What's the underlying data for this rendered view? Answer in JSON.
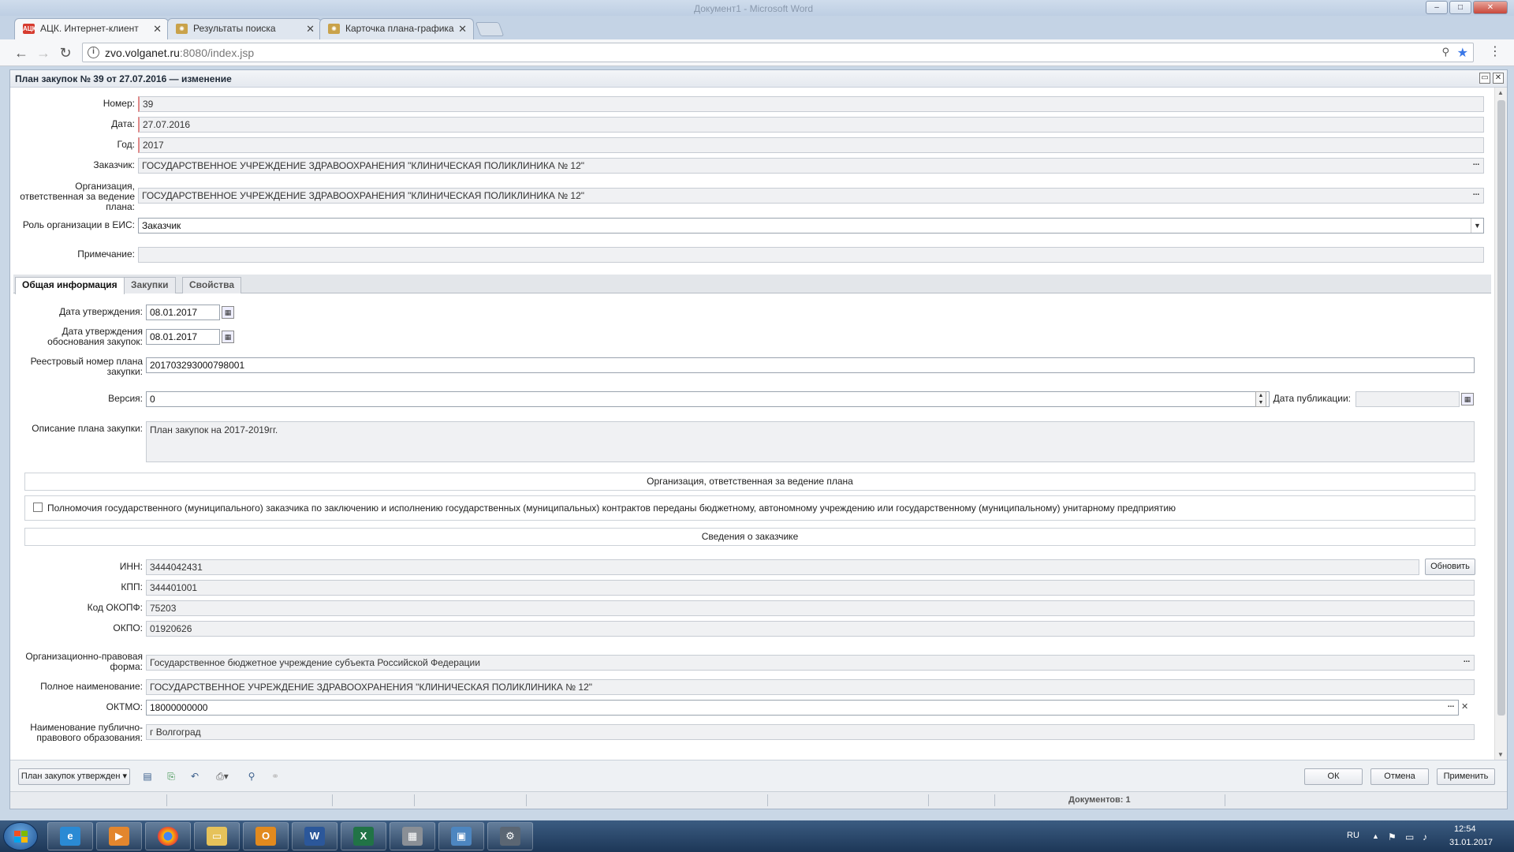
{
  "browser": {
    "title_faded": "Документ1 - Microsoft Word",
    "tabs": [
      {
        "label": "АЦК. Интернет-клиент",
        "active": true
      },
      {
        "label": "Результаты поиска",
        "active": false
      },
      {
        "label": "Карточка плана-графика",
        "active": false
      }
    ],
    "url_host": "zvo.volganet.ru",
    "url_path": ":8080/index.jsp"
  },
  "app": {
    "title": "План закупок № 39 от 27.07.2016 — изменение",
    "header_fields": {
      "number_label": "Номер:",
      "number_value": "39",
      "date_label": "Дата:",
      "date_value": "27.07.2016",
      "year_label": "Год:",
      "year_value": "2017",
      "customer_label": "Заказчик:",
      "customer_value": "ГОСУДАРСТВЕННОЕ УЧРЕЖДЕНИЕ ЗДРАВООХРАНЕНИЯ \"КЛИНИЧЕСКАЯ ПОЛИКЛИНИКА № 12\"",
      "org_label": "Организация, ответственная за ведение плана:",
      "org_value": "ГОСУДАРСТВЕННОЕ УЧРЕЖДЕНИЕ ЗДРАВООХРАНЕНИЯ \"КЛИНИЧЕСКАЯ ПОЛИКЛИНИКА № 12\"",
      "role_label": "Роль организации в ЕИС:",
      "role_value": "Заказчик",
      "note_label": "Примечание:",
      "note_value": ""
    },
    "form_tabs": [
      {
        "label": "Общая информация",
        "active": true
      },
      {
        "label": "Закупки",
        "active": false
      },
      {
        "label": "Свойства",
        "active": false
      }
    ],
    "general": {
      "approval_date_label": "Дата утверждения:",
      "approval_date_value": "08.01.2017",
      "justification_date_label": "Дата утверждения обоснования закупок:",
      "justification_date_value": "08.01.2017",
      "registry_number_label": "Реестровый номер плана закупки:",
      "registry_number_value": "201703293000798001",
      "version_label": "Версия:",
      "version_value": "0",
      "publication_date_label": "Дата публикации:",
      "publication_date_value": "",
      "description_label": "Описание плана закупки:",
      "description_value": "План закупок на 2017-2019гг."
    },
    "section_org": "Организация, ответственная за ведение плана",
    "authority_checkbox_label": "Полномочия государственного (муниципального) заказчика по заключению и исполнению государственных (муниципальных) контрактов переданы бюджетному, автономному учреждению или государственному (муниципальному) унитарному предприятию",
    "section_customer": "Сведения о заказчике",
    "customer_info": {
      "inn_label": "ИНН:",
      "inn_value": "3444042431",
      "refresh_label": "Обновить",
      "kpp_label": "КПП:",
      "kpp_value": "344401001",
      "okopf_label": "Код ОКОПФ:",
      "okopf_value": "75203",
      "okpo_label": "ОКПО:",
      "okpo_value": "01920626",
      "legal_form_label": "Организационно-правовая форма:",
      "legal_form_value": "Государственное бюджетное учреждение субъекта Российской Федерации",
      "full_name_label": "Полное наименование:",
      "full_name_value": "ГОСУДАРСТВЕННОЕ УЧРЕЖДЕНИЕ ЗДРАВООХРАНЕНИЯ \"КЛИНИЧЕСКАЯ ПОЛИКЛИНИКА № 12\"",
      "oktmo_label": "ОКТМО:",
      "oktmo_value": "18000000000",
      "municipality_label": "Наименование публично-правового образования:",
      "municipality_value": "г Волгоград"
    },
    "footer": {
      "status_dropdown": "План закупок утвержден",
      "ok_label": "ОК",
      "cancel_label": "Отмена",
      "apply_label": "Применить"
    },
    "statusbar": {
      "documents": "Документов: 1"
    }
  },
  "taskbar": {
    "lang": "RU",
    "time": "12:54",
    "date": "31.01.2017"
  },
  "colors": {
    "accent_blue": "#3b78e7",
    "taskbar": "#1d3757",
    "required_border": "#e18a8a"
  }
}
